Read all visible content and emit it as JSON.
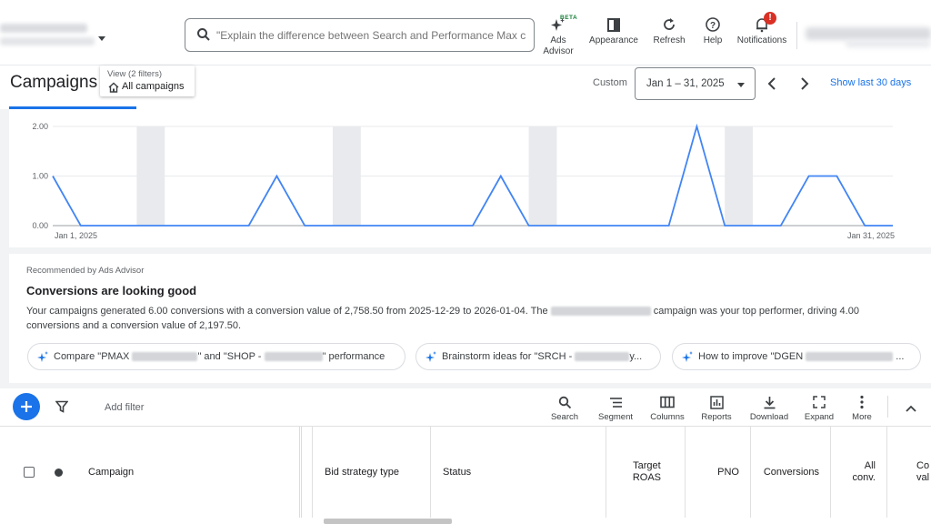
{
  "topbar": {
    "search_placeholder": "\"Explain the difference between Search and Performance Max cam...",
    "ads_advisor_label_1": "Ads",
    "ads_advisor_label_2": "Advisor",
    "beta_badge": "BETA",
    "appearance_label": "Appearance",
    "refresh_label": "Refresh",
    "help_label": "Help",
    "notifications_label": "Notifications",
    "notifications_count": "!"
  },
  "titlerow": {
    "page_title": "Campaigns",
    "view_filters": "View (2 filters)",
    "view_name": "All campaigns",
    "custom_label": "Custom",
    "date_range": "Jan 1 – 31, 2025",
    "show_last": "Show last 30 days"
  },
  "chart_data": {
    "type": "line",
    "y_ticks": [
      "2.00",
      "1.00",
      "0.00"
    ],
    "ylim": [
      0,
      2
    ],
    "x_start_label": "Jan 1, 2025",
    "x_end_label": "Jan 31, 2025",
    "series": [
      {
        "values": [
          1,
          0,
          0,
          0,
          0,
          0,
          0,
          0,
          1,
          0,
          0,
          0,
          0,
          0,
          0,
          0,
          1,
          0,
          0,
          0,
          0,
          0,
          0,
          2,
          0,
          0,
          0,
          1,
          1,
          0,
          0
        ]
      }
    ],
    "weekend_bands": [
      [
        3,
        4
      ],
      [
        10,
        11
      ],
      [
        17,
        18
      ],
      [
        24,
        25
      ]
    ],
    "line_color": "#4285f4",
    "band_color": "#e8eaed"
  },
  "advisor": {
    "recommended_by": "Recommended by Ads Advisor",
    "title": "Conversions are looking good",
    "body_part1": "Your campaigns generated 6.00 conversions with a conversion value of 2,758.50 from 2025-12-29 to 2026-01-04. The",
    "body_part2": "campaign was your top performer, driving 4.00 conversions and a conversion value of 2,197.50.",
    "chip1_a": "Compare \"PMAX",
    "chip1_b": "\" and \"SHOP -",
    "chip1_c": "\" performance",
    "chip2_a": "Brainstorm ideas for \"SRCH -",
    "chip2_b": "y...",
    "chip3_a": "How to improve \"DGEN",
    "chip3_b": "..."
  },
  "table_toolbar": {
    "add_filter": "Add filter",
    "search": "Search",
    "segment": "Segment",
    "columns": "Columns",
    "reports": "Reports",
    "download": "Download",
    "expand": "Expand",
    "more": "More"
  },
  "table_header": {
    "campaign": "Campaign",
    "bid_strategy": "Bid strategy type",
    "status": "Status",
    "target_roas_1": "Target",
    "target_roas_2": "ROAS",
    "pno": "PNO",
    "conversions": "Conversions",
    "all_conv_1": "All",
    "all_conv_2": "conv.",
    "conv_value_1": "Co",
    "conv_value_2": "val"
  }
}
